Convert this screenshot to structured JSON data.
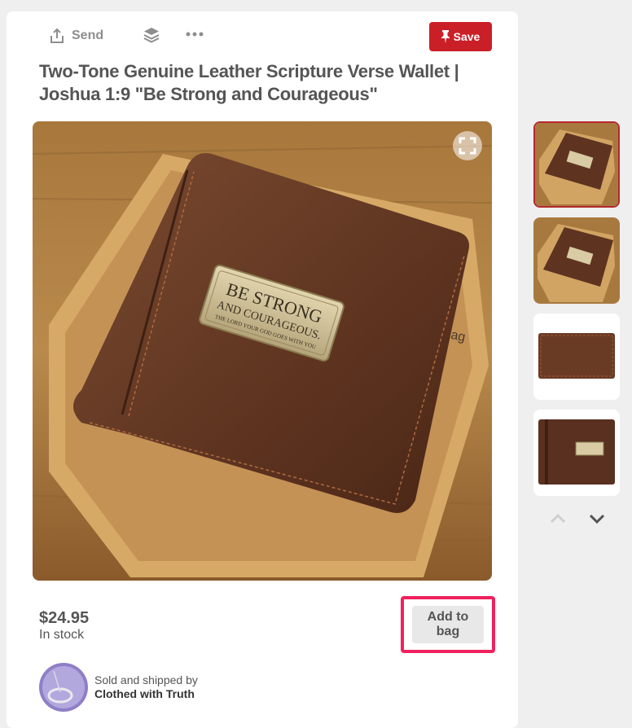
{
  "toolbar": {
    "send_label": "Send",
    "save_label": "Save",
    "icons": [
      "share-icon",
      "layers-icon",
      "more-icon",
      "pin-icon"
    ]
  },
  "product": {
    "title": "Two-Tone Genuine Leather Scripture Verse Wallet | Joshua 1:9 \"Be Strong and Courageous\"",
    "price": "$24.95",
    "stock": "In stock",
    "badge_line1": "BE STRONG",
    "badge_line2": "AND COURAGEOUS.",
    "badge_line3": "THE LORD YOUR GOD GOES WITH YOU",
    "box_brand": "cag"
  },
  "actions": {
    "add_to_bag_label": "Add to bag"
  },
  "seller": {
    "prefix": "Sold and shipped by",
    "name": "Clothed with Truth"
  },
  "thumbnails": {
    "selected_index": 0,
    "count": 4
  },
  "colors": {
    "save": "#cb1f27",
    "highlight": "#f0215e",
    "thumb_active_border": "#b6282d"
  }
}
